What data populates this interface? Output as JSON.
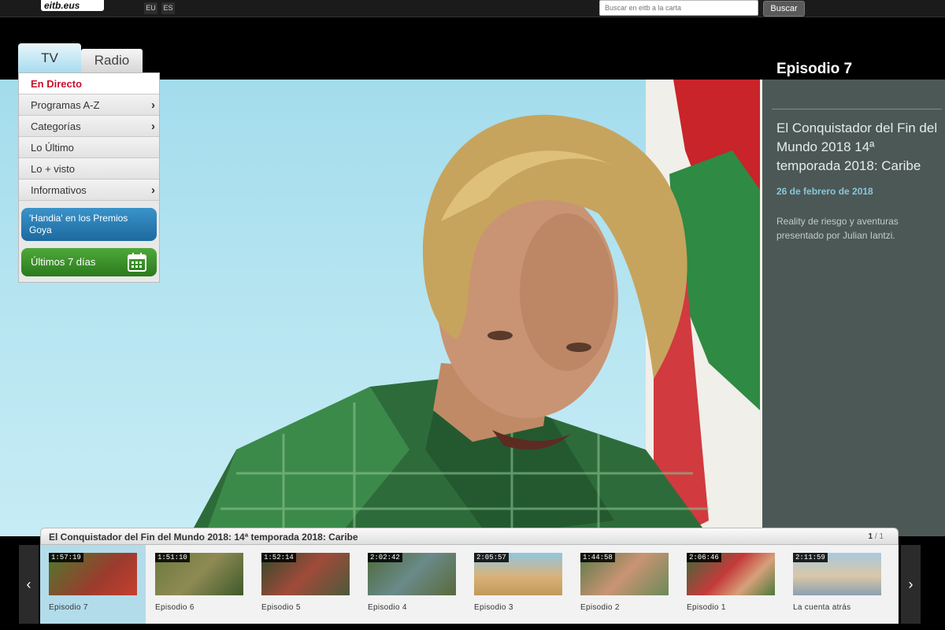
{
  "header": {
    "logo": "eitb.eus",
    "languages": [
      "EU",
      "ES"
    ],
    "search": {
      "placeholder": "Buscar en eitb a la carta",
      "button": "Buscar"
    }
  },
  "tabs": [
    {
      "label": "TV",
      "active": true
    },
    {
      "label": "Radio",
      "active": false
    }
  ],
  "menu": {
    "items": [
      {
        "label": "En Directo",
        "live": true,
        "has_submenu": false
      },
      {
        "label": "Programas A-Z",
        "has_submenu": true
      },
      {
        "label": "Categorías",
        "has_submenu": true
      },
      {
        "label": "Lo Último",
        "has_submenu": false
      },
      {
        "label": "Lo + visto",
        "has_submenu": false
      },
      {
        "label": "Informativos",
        "has_submenu": true
      }
    ],
    "promo_goya": "'Handia' en los Premios Goya",
    "promo_week": "Últimos 7 días",
    "chevron": "›"
  },
  "episode": {
    "title": "Episodio 7",
    "show": "El Conquistador del Fin del Mundo 2018 14ª temporada 2018: Caribe",
    "date": "26 de febrero de 2018",
    "description": "Reality de riesgo y aventuras presentado por Julian Iantzi."
  },
  "carousel": {
    "title": "El Conquistador del Fin del Mundo 2018: 14ª temporada 2018: Caribe",
    "page_current": "1",
    "page_sep": "/",
    "page_total": "1",
    "prev": "‹",
    "next": "›",
    "items": [
      {
        "duration": "1:57:19",
        "label": "Episodio 7",
        "active": true
      },
      {
        "duration": "1:51:10",
        "label": "Episodio 6"
      },
      {
        "duration": "1:52:14",
        "label": "Episodio 5"
      },
      {
        "duration": "2:02:42",
        "label": "Episodio 4"
      },
      {
        "duration": "2:05:57",
        "label": "Episodio 3"
      },
      {
        "duration": "1:44:58",
        "label": "Episodio 2"
      },
      {
        "duration": "2:06:46",
        "label": "Episodio 1"
      },
      {
        "duration": "2:11:59",
        "label": "La cuenta atrás"
      }
    ]
  },
  "colors": {
    "live": "#c8102e",
    "date": "#88c6dd",
    "active_thumb": "#b3dcea"
  }
}
